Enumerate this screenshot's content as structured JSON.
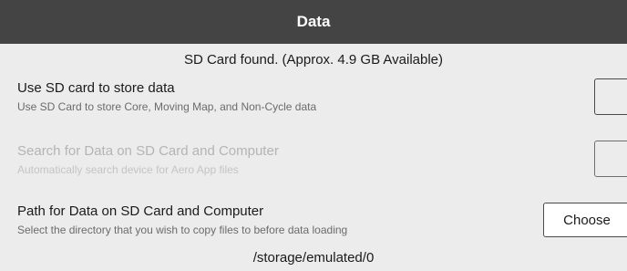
{
  "header": {
    "title": "Data"
  },
  "sd_status": "SD Card found. (Approx. 4.9 GB Available)",
  "settings": [
    {
      "title": "Use SD card to store data",
      "subtitle": "Use SD Card to store Core, Moving Map, and Non-Cycle data",
      "control": "checkbox",
      "checked": false,
      "enabled": true
    },
    {
      "title": "Search for Data on SD Card and Computer",
      "subtitle": "Automatically search device for Aero App files",
      "control": "checkbox",
      "checked": false,
      "enabled": false
    },
    {
      "title": "Path for Data on SD Card and Computer",
      "subtitle": "Select the directory that you wish to copy files to before data loading",
      "control": "button",
      "button_label": "Choose",
      "enabled": true
    }
  ],
  "path_value": "/storage/emulated/0",
  "colors": {
    "header_bg": "#444444",
    "page_bg": "#ececec",
    "disabled_text": "#b4b4b4"
  }
}
